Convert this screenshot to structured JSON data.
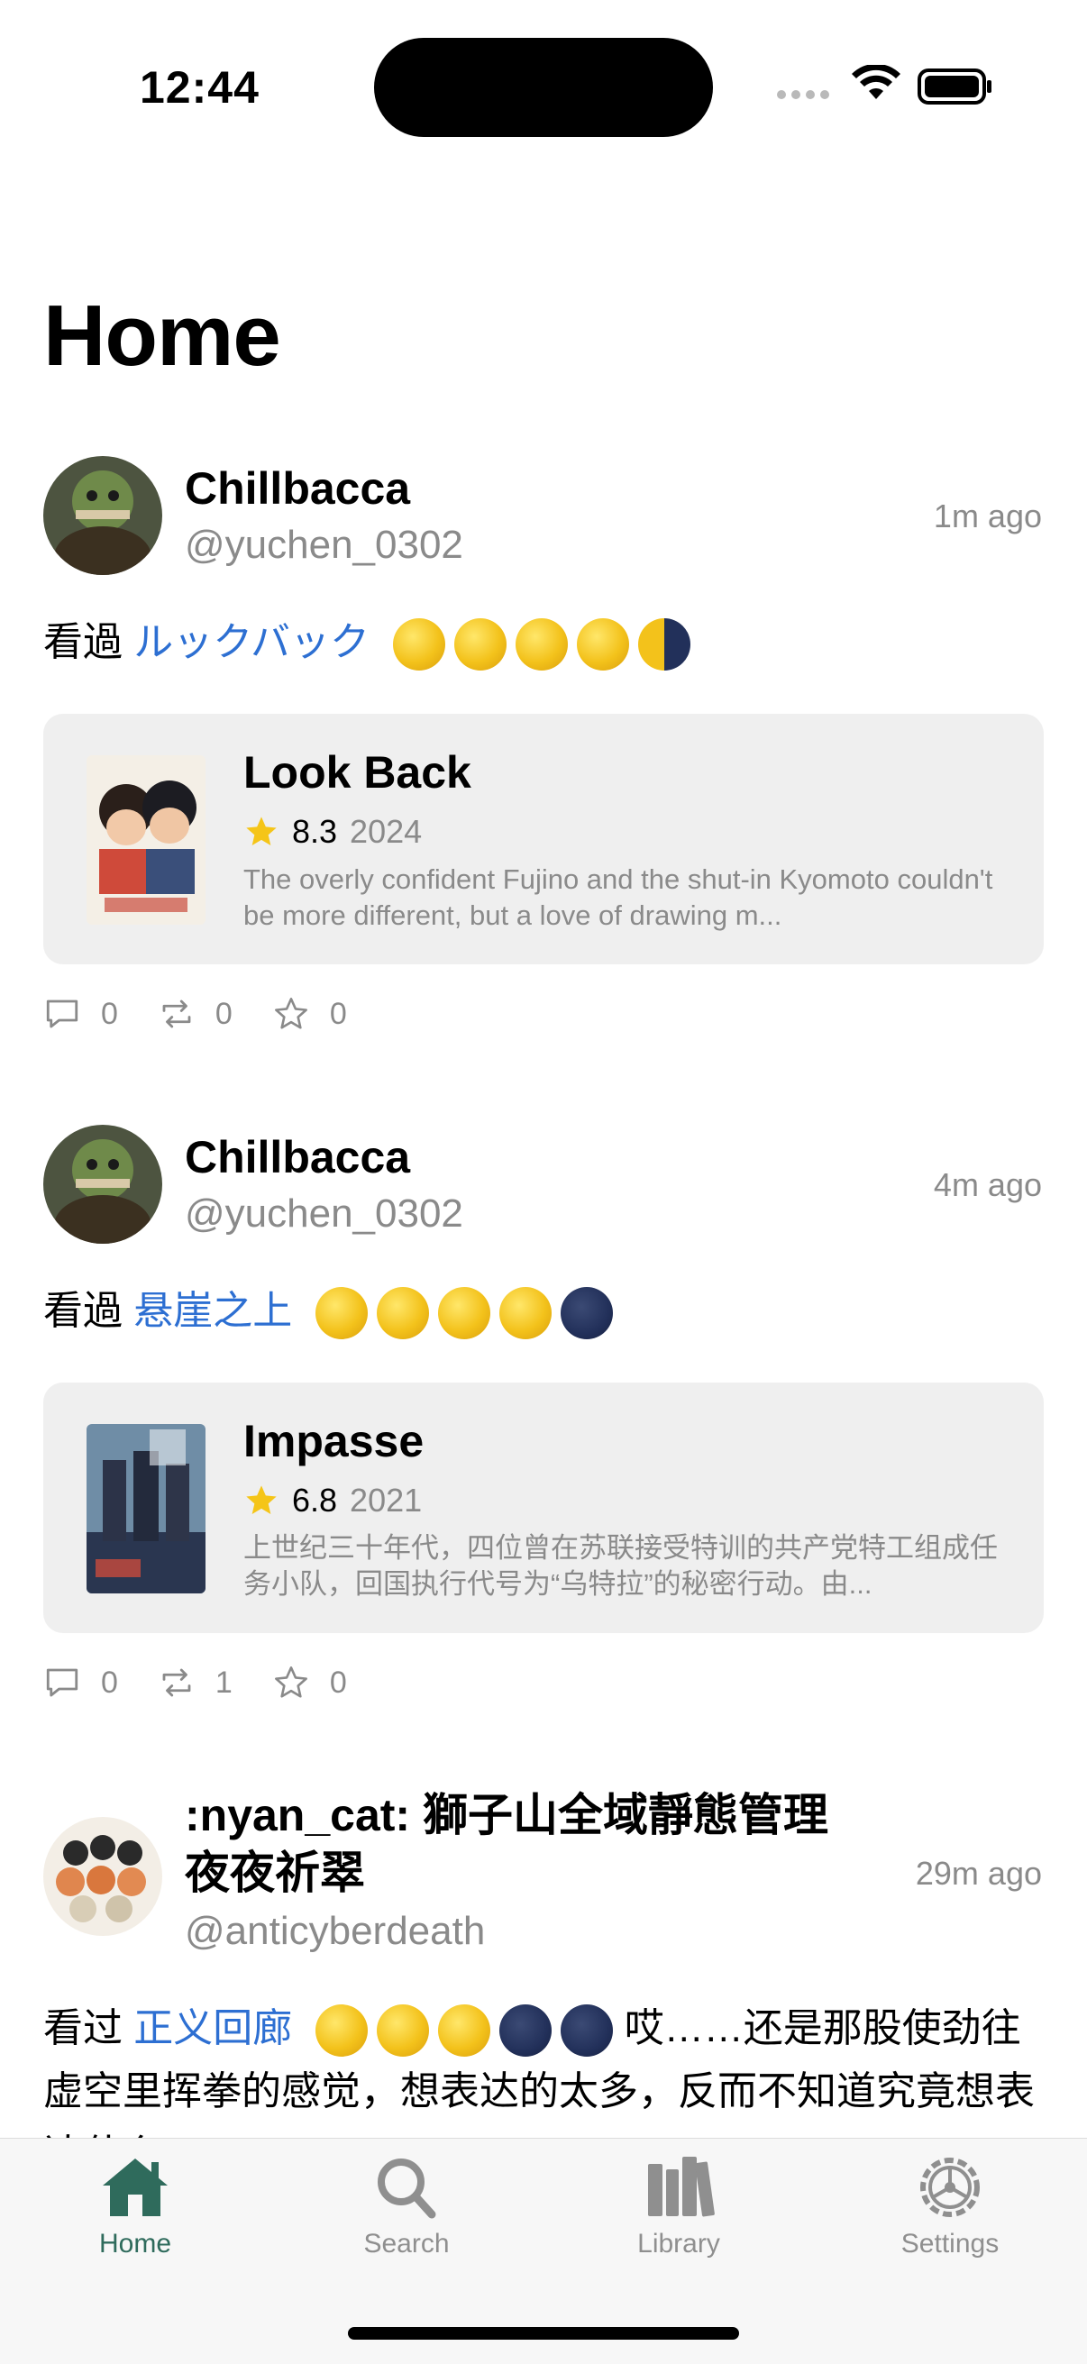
{
  "status_bar": {
    "time": "12:44"
  },
  "page_title": "Home",
  "posts": [
    {
      "display_name": "Chillbacca",
      "handle": "@yuchen_0302",
      "time_ago": "1m ago",
      "verb": "看過",
      "title_link": "ルックバック",
      "moons": [
        "full",
        "full",
        "full",
        "full",
        "half"
      ],
      "card": {
        "title": "Look Back",
        "score": "8.3",
        "year": "2024",
        "synopsis": "The overly confident Fujino and the shut-in Kyomoto couldn't be more different, but a love of drawing m..."
      },
      "counts": {
        "replies": "0",
        "reposts": "0",
        "favorites": "0"
      }
    },
    {
      "display_name": "Chillbacca",
      "handle": "@yuchen_0302",
      "time_ago": "4m ago",
      "verb": "看過",
      "title_link": "悬崖之上",
      "moons": [
        "full",
        "full",
        "full",
        "full",
        "new"
      ],
      "card": {
        "title": "Impasse",
        "score": "6.8",
        "year": "2021",
        "synopsis": "上世纪三十年代，四位曾在苏联接受特训的共产党特工组成任务小队，回国执行代号为“乌特拉”的秘密行动。由..."
      },
      "counts": {
        "replies": "0",
        "reposts": "1",
        "favorites": "0"
      }
    },
    {
      "display_name": ":nyan_cat: 獅子山全域靜態管理夜夜祈翠",
      "handle": "@anticyberdeath",
      "time_ago": "29m ago",
      "verb": "看过",
      "title_link": "正义回廊",
      "moons": [
        "full",
        "full",
        "full",
        "new",
        "new"
      ],
      "text_after": "哎……还是那股使劲往虚空里挥拳的感觉，想表达的太多，反而不知道究竟想表达什么"
    }
  ],
  "tabs": [
    {
      "label": "Home",
      "icon": "house-icon"
    },
    {
      "label": "Search",
      "icon": "magnifier-icon"
    },
    {
      "label": "Library",
      "icon": "books-icon"
    },
    {
      "label": "Settings",
      "icon": "gear-icon"
    }
  ],
  "colors": {
    "accent": "#2f6b5c",
    "link": "#2d6fd2",
    "star": "#f5c518"
  }
}
